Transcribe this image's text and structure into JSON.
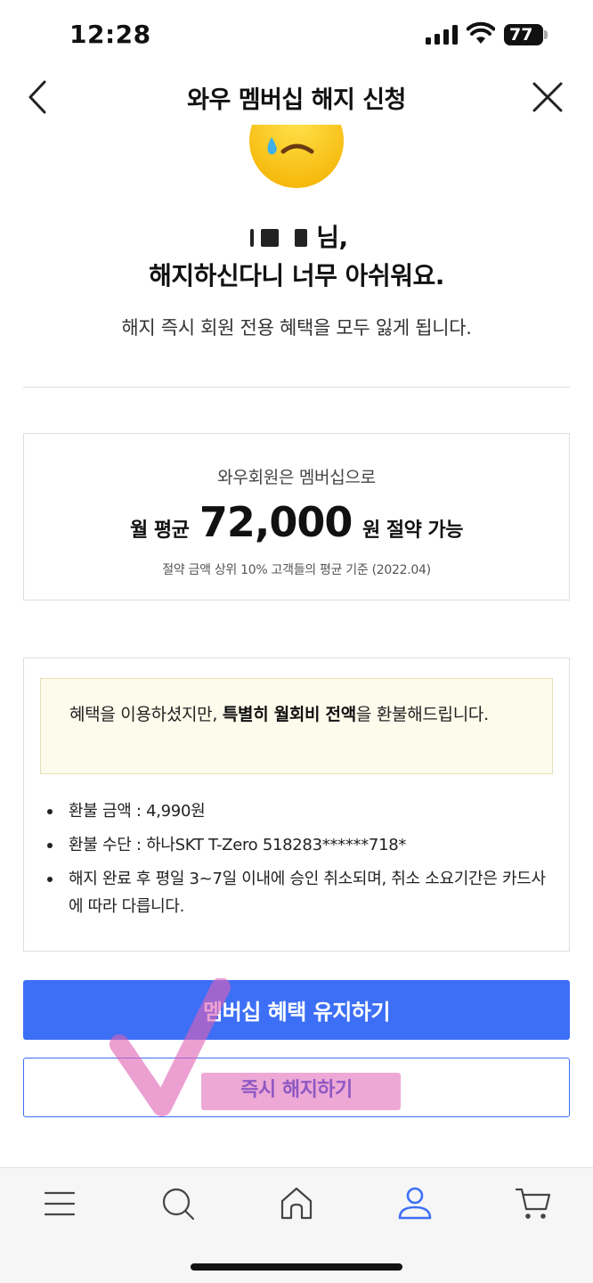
{
  "status_bar": {
    "time": "12:28",
    "battery": "77"
  },
  "header": {
    "title": "와우 멤버십 해지 신청"
  },
  "farewell": {
    "name_suffix": "님,",
    "sorry": "해지하신다니 너무 아쉬워요.",
    "lose_benefits": "해지 즉시 회원 전용 혜택을 모두 잃게 됩니다."
  },
  "savings": {
    "intro": "와우회원은 멤버십으로",
    "prefix": "월 평균",
    "amount": "72,000",
    "suffix": "원 절약 가능",
    "note": "절약 금액 상위 10% 고객들의 평균 기준 (2022.04)"
  },
  "refund": {
    "notice_pre": "혜택을 이용하셨지만, ",
    "notice_bold": "특별히 월회비 전액",
    "notice_post": "을 환불해드립니다.",
    "items": [
      "환불 금액 : 4,990원",
      "환불 수단 : 하나SKT T-Zero 518283******718*",
      "해지 완료 후 평일 3~7일 이내에 승인 취소되며, 취소 소요기간은 카드사에 따라 다릅니다."
    ]
  },
  "buttons": {
    "keep": "멤버십 혜택 유지하기",
    "cancel": "즉시 해지하기"
  },
  "bottom_nav": {
    "items": [
      "menu-icon",
      "search-icon",
      "home-icon",
      "user-icon",
      "cart-icon"
    ],
    "active": "user-icon",
    "active_color": "#3d6ff6"
  },
  "colors": {
    "primary": "#3d6ff6",
    "annotation": "#e060b4"
  }
}
